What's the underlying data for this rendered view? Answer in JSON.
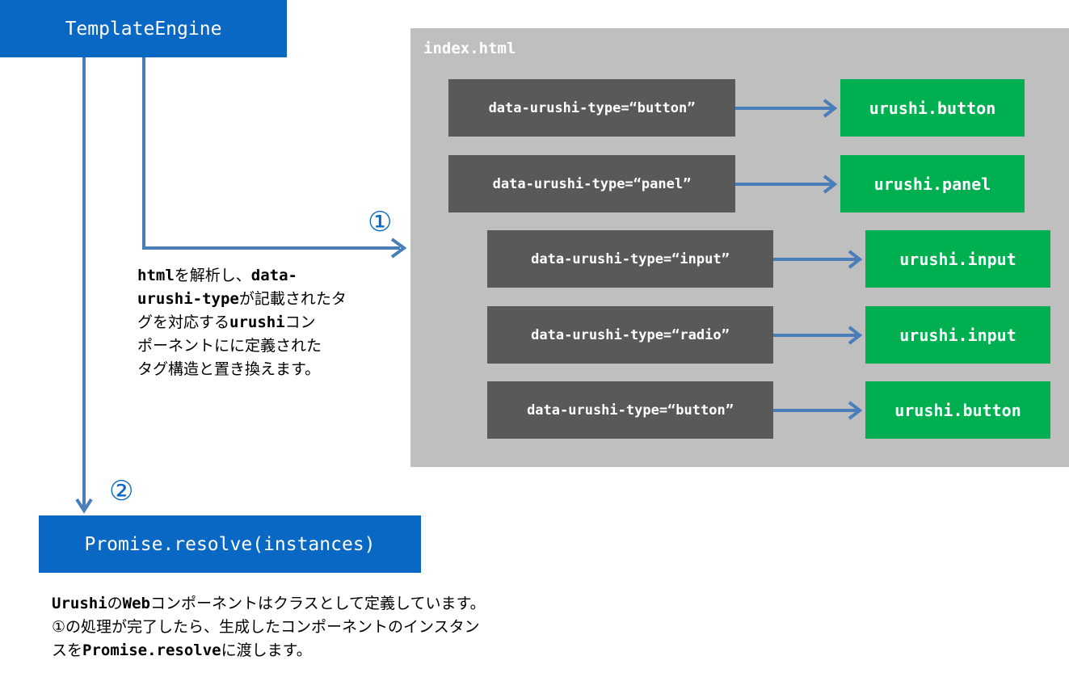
{
  "template_engine": {
    "label": "TemplateEngine"
  },
  "index_panel": {
    "title": "index.html"
  },
  "mappings": [
    {
      "tag": "data-urushi-type=“button”",
      "component": "urushi.button"
    },
    {
      "tag": "data-urushi-type=“panel”",
      "component": "urushi.panel"
    },
    {
      "tag": "data-urushi-type=“input”",
      "component": "urushi.input"
    },
    {
      "tag": "data-urushi-type=“radio”",
      "component": "urushi.input"
    },
    {
      "tag": "data-urushi-type=“button”",
      "component": "urushi.button"
    }
  ],
  "markers": {
    "step1": "①",
    "step2": "②"
  },
  "note1": {
    "line1_bold": "html",
    "line1_rest": "を解析し、",
    "line1_bold2": "data-",
    "line2_bold": "urushi-type",
    "line2_rest": "が記載されたタ",
    "line3_pre": "グを対応する",
    "line3_bold": "urushi",
    "line3_rest": "コン",
    "line4": "ポーネントにに定義された",
    "line5": "タグ構造と置き換えます。"
  },
  "promise_box": {
    "label": "Promise.resolve(instances)"
  },
  "note2": {
    "line1_bold": "Urushi",
    "line1_mid": "の",
    "line1_bold2": "Web",
    "line1_rest": "コンポーネントはクラスとして定義しています。",
    "line2": "①の処理が完了したら、生成したコンポーネントのインスタン",
    "line3_pre": "スを",
    "line3_bold": "Promise.resolve",
    "line3_rest": "に渡します。"
  },
  "colors": {
    "blue": "#0968c3",
    "arrow": "#4a7ebb",
    "panel": "#bfbfbf",
    "tag": "#595959",
    "component": "#00b050"
  }
}
